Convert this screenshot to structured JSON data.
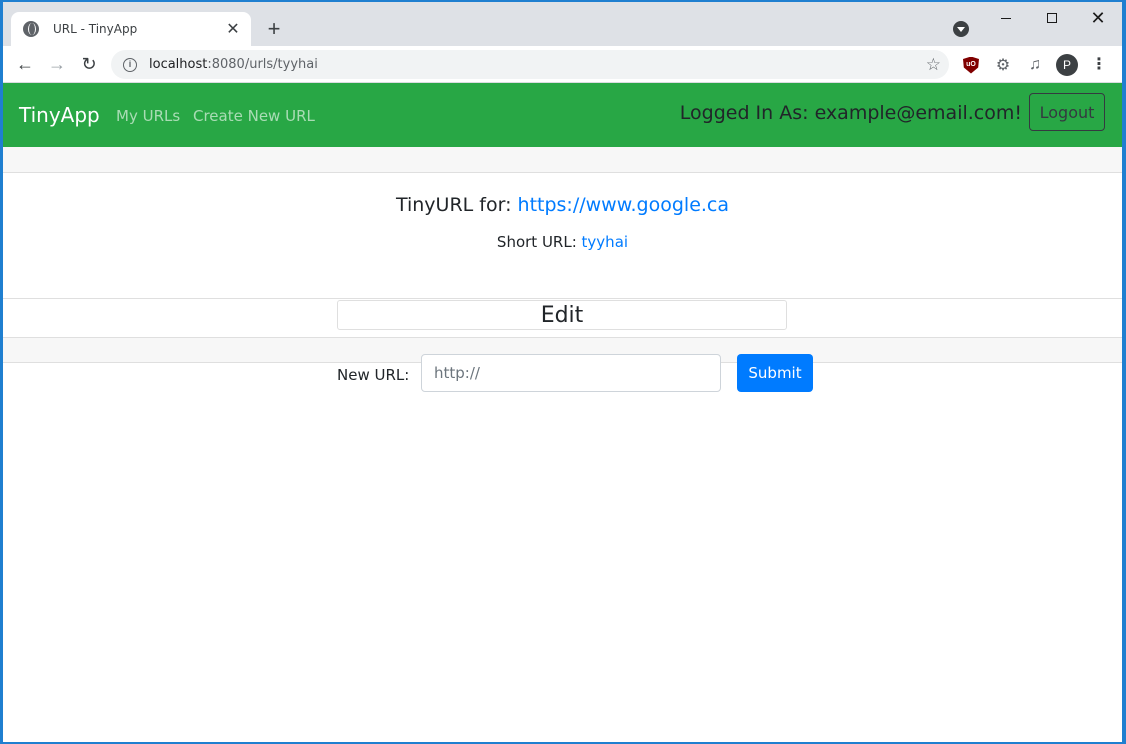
{
  "browser": {
    "tab_title": "URL - TinyApp",
    "tab_close": "✕",
    "new_tab": "+",
    "url_host": "localhost",
    "url_rest": ":8080/urls/tyyhai",
    "avatar_letter": "P",
    "window_controls": {
      "close": "✕"
    }
  },
  "navbar": {
    "brand": "TinyApp",
    "links": [
      "My URLs",
      "Create New URL"
    ],
    "logged_in_text": "Logged In As: example@email.com!",
    "logout_label": "Logout",
    "accent_color": "#28a745"
  },
  "card": {
    "title_prefix": "TinyURL for:",
    "long_url": "https://www.google.ca",
    "short_label": "Short URL:",
    "short_url": "tyyhai"
  },
  "edit": {
    "heading": "Edit",
    "label": "New URL:",
    "input_value": "",
    "placeholder": "http://",
    "submit_label": "Submit"
  }
}
